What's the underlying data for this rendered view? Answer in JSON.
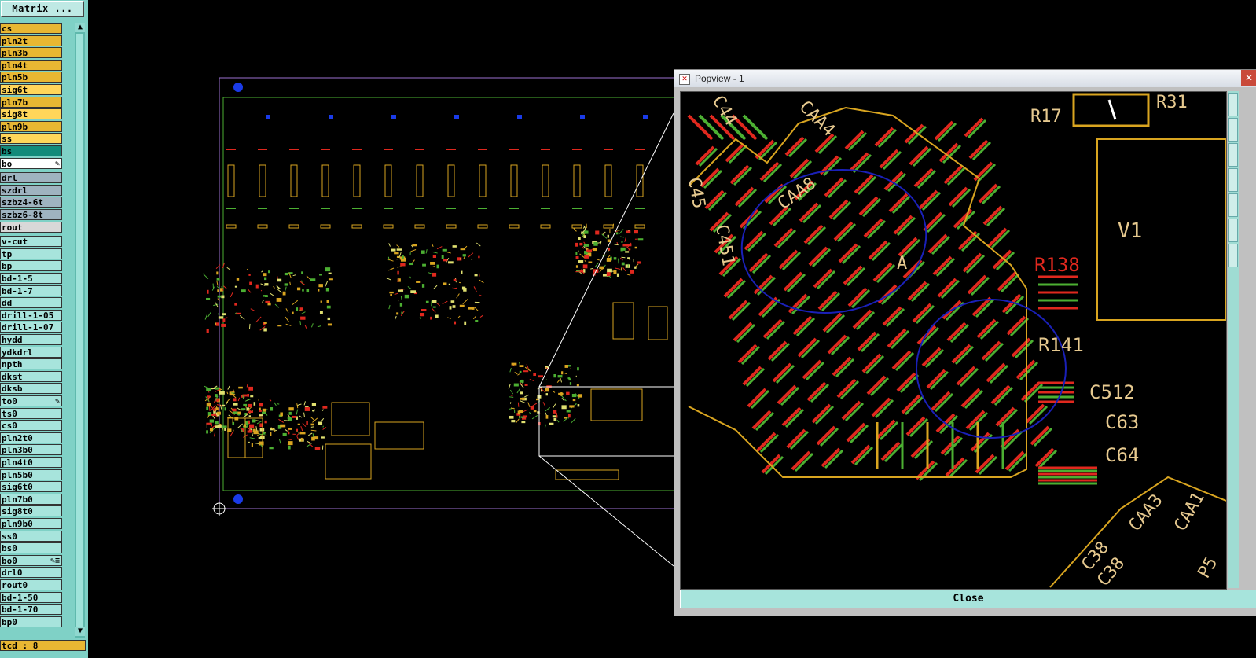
{
  "matrix_button": "Matrix ...",
  "layers": [
    {
      "name": "cs",
      "color": "#e8b733"
    },
    {
      "name": "pln2t",
      "color": "#e8b733"
    },
    {
      "name": "pln3b",
      "color": "#e8b733"
    },
    {
      "name": "pln4t",
      "color": "#e8b733"
    },
    {
      "name": "pln5b",
      "color": "#e8b733"
    },
    {
      "name": "sig6t",
      "color": "#ffd65a"
    },
    {
      "name": "pln7b",
      "color": "#e8b733"
    },
    {
      "name": "sig8t",
      "color": "#ffd65a"
    },
    {
      "name": "pln9b",
      "color": "#e8b733"
    },
    {
      "name": "ss",
      "color": "#ffd65a"
    },
    {
      "name": "bs",
      "color": "#138a7a"
    },
    {
      "name": "bo",
      "color": "#ffffff",
      "tag": "✎"
    },
    {
      "name": "drl",
      "color": "#9fb3c0"
    },
    {
      "name": "szdrl",
      "color": "#9fb3c0"
    },
    {
      "name": "szbz4-6t",
      "color": "#9fb3c0"
    },
    {
      "name": "szbz6-8t",
      "color": "#9fb3c0"
    },
    {
      "name": "rout",
      "color": "#d8d8d8"
    },
    {
      "name": "v-cut",
      "color": "#a7e4dc"
    },
    {
      "name": "tp",
      "color": "#a7e4dc"
    },
    {
      "name": "bp",
      "color": "#a7e4dc"
    },
    {
      "name": "bd-1-5",
      "color": "#a7e4dc"
    },
    {
      "name": "bd-1-7",
      "color": "#a7e4dc"
    },
    {
      "name": "dd",
      "color": "#a7e4dc"
    },
    {
      "name": "drill-1-05",
      "color": "#a7e4dc"
    },
    {
      "name": "drill-1-07",
      "color": "#a7e4dc"
    },
    {
      "name": "hydd",
      "color": "#a7e4dc"
    },
    {
      "name": "ydkdrl",
      "color": "#a7e4dc"
    },
    {
      "name": "npth",
      "color": "#a7e4dc"
    },
    {
      "name": "dkst",
      "color": "#a7e4dc"
    },
    {
      "name": "dksb",
      "color": "#a7e4dc"
    },
    {
      "name": "to0",
      "color": "#a7e4dc",
      "tag": "✎"
    },
    {
      "name": "ts0",
      "color": "#a7e4dc"
    },
    {
      "name": "cs0",
      "color": "#a7e4dc"
    },
    {
      "name": "pln2t0",
      "color": "#a7e4dc"
    },
    {
      "name": "pln3b0",
      "color": "#a7e4dc"
    },
    {
      "name": "pln4t0",
      "color": "#a7e4dc"
    },
    {
      "name": "pln5b0",
      "color": "#a7e4dc"
    },
    {
      "name": "sig6t0",
      "color": "#a7e4dc"
    },
    {
      "name": "pln7b0",
      "color": "#a7e4dc"
    },
    {
      "name": "sig8t0",
      "color": "#a7e4dc"
    },
    {
      "name": "pln9b0",
      "color": "#a7e4dc"
    },
    {
      "name": "ss0",
      "color": "#a7e4dc"
    },
    {
      "name": "bs0",
      "color": "#a7e4dc"
    },
    {
      "name": "bo0",
      "color": "#a7e4dc",
      "tag": "✎≡"
    },
    {
      "name": "drl0",
      "color": "#a7e4dc"
    },
    {
      "name": "rout0",
      "color": "#a7e4dc"
    },
    {
      "name": "bd-1-50",
      "color": "#a7e4dc"
    },
    {
      "name": "bd-1-70",
      "color": "#a7e4dc"
    },
    {
      "name": "bp0",
      "color": "#a7e4dc"
    }
  ],
  "bottom_layer": "tcd : 8",
  "popview": {
    "title": "Popview - 1",
    "close_label": "Close",
    "labels": [
      "R17",
      "R31",
      "V1",
      "R138",
      "R141",
      "C512",
      "C63",
      "C64",
      "A",
      "CAA8",
      "C44",
      "C45",
      "CAA4",
      "C451",
      "CAA3",
      "C38",
      "CAA1",
      "C38",
      "P5"
    ]
  },
  "colors": {
    "copper": "#d9a520",
    "trace_green": "#4caf32",
    "trace_red": "#e0281e",
    "highlight": "#1a20b8",
    "panel": "#7fd1c6",
    "board_outline": "#9b6fd0"
  }
}
